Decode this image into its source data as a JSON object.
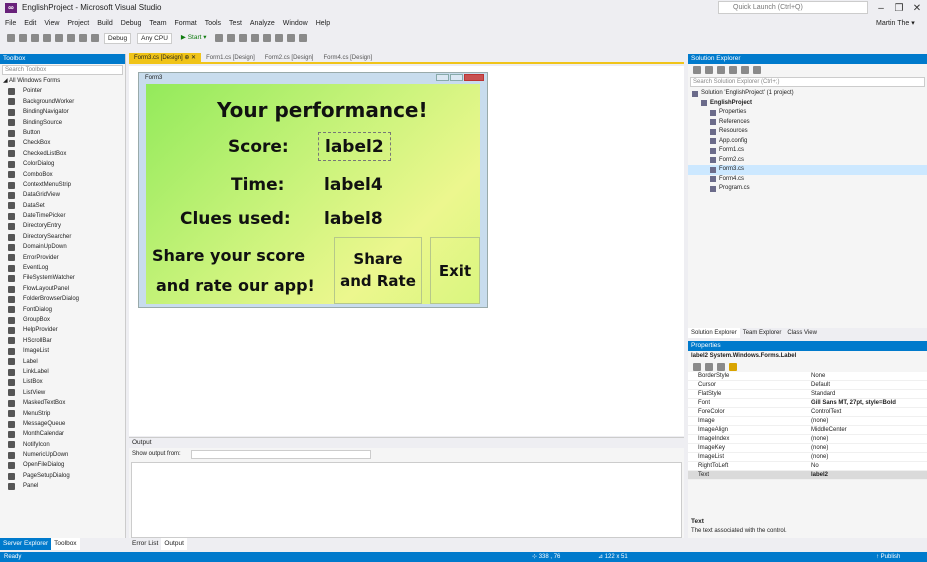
{
  "title": "EnglishProject - Microsoft Visual Studio",
  "quick_launch": "Quick Launch (Ctrl+Q)",
  "user": "Martin The ▾",
  "menu": [
    "File",
    "Edit",
    "View",
    "Project",
    "Build",
    "Debug",
    "Team",
    "Format",
    "Tools",
    "Test",
    "Analyze",
    "Window",
    "Help"
  ],
  "toolbar": {
    "config": "Debug",
    "platform": "Any CPU",
    "start": "▶ Start ▾"
  },
  "toolbox": {
    "title": "Toolbox",
    "search": "Search Toolbox",
    "group": "◢ All Windows Forms",
    "items": [
      "Pointer",
      "BackgroundWorker",
      "BindingNavigator",
      "BindingSource",
      "Button",
      "CheckBox",
      "CheckedListBox",
      "ColorDialog",
      "ComboBox",
      "ContextMenuStrip",
      "DataGridView",
      "DataSet",
      "DateTimePicker",
      "DirectoryEntry",
      "DirectorySearcher",
      "DomainUpDown",
      "ErrorProvider",
      "EventLog",
      "FileSystemWatcher",
      "FlowLayoutPanel",
      "FolderBrowserDialog",
      "FontDialog",
      "GroupBox",
      "HelpProvider",
      "HScrollBar",
      "ImageList",
      "Label",
      "LinkLabel",
      "ListBox",
      "ListView",
      "MaskedTextBox",
      "MenuStrip",
      "MessageQueue",
      "MonthCalendar",
      "NotifyIcon",
      "NumericUpDown",
      "OpenFileDialog",
      "PageSetupDialog",
      "Panel"
    ],
    "tabs": [
      "Server Explorer",
      "Toolbox"
    ]
  },
  "doctabs": [
    "Form3.cs [Design] ⊕ ✕",
    "Form1.cs [Design]",
    "Form2.cs [Design]",
    "Form4.cs [Design]"
  ],
  "form": {
    "title": "Form3",
    "heading": "Your performance!",
    "score_label": "Score:",
    "score_value": "label2",
    "time_label": "Time:",
    "time_value": "label4",
    "clues_label": "Clues used:",
    "clues_value": "label8",
    "share_line1": "Share your score",
    "share_line2": "and rate our app!",
    "share_btn_1": "Share",
    "share_btn_2": "and Rate",
    "exit_btn": "Exit"
  },
  "output": {
    "title": "Output",
    "show_from": "Show output from:",
    "tabs": [
      "Error List",
      "Output"
    ]
  },
  "solution": {
    "title": "Solution Explorer",
    "search": "Search Solution Explorer (Ctrl+;)",
    "items": [
      {
        "t": "Solution 'EnglishProject' (1 project)",
        "l": 0
      },
      {
        "t": "EnglishProject",
        "l": 1,
        "b": true
      },
      {
        "t": "Properties",
        "l": 2
      },
      {
        "t": "References",
        "l": 2
      },
      {
        "t": "Resources",
        "l": 2
      },
      {
        "t": "App.config",
        "l": 2
      },
      {
        "t": "Form1.cs",
        "l": 2
      },
      {
        "t": "Form2.cs",
        "l": 2
      },
      {
        "t": "Form3.cs",
        "l": 2,
        "sel": true
      },
      {
        "t": "Form4.cs",
        "l": 2
      },
      {
        "t": "Program.cs",
        "l": 2
      }
    ],
    "tabs": [
      "Solution Explorer",
      "Team Explorer",
      "Class View"
    ]
  },
  "properties": {
    "title": "Properties",
    "object": "label2  System.Windows.Forms.Label",
    "rows": [
      [
        "BorderStyle",
        "None"
      ],
      [
        "Cursor",
        "Default"
      ],
      [
        "FlatStyle",
        "Standard"
      ],
      [
        "Font",
        "Gill Sans MT, 27pt, style=Bold"
      ],
      [
        "ForeColor",
        "ControlText"
      ],
      [
        "Image",
        "(none)"
      ],
      [
        "ImageAlign",
        "MiddleCenter"
      ],
      [
        "ImageIndex",
        "(none)"
      ],
      [
        "ImageKey",
        "(none)"
      ],
      [
        "ImageList",
        "(none)"
      ],
      [
        "RightToLeft",
        "No"
      ],
      [
        "Text",
        "label2"
      ]
    ],
    "desc_title": "Text",
    "desc": "The text associated with the control."
  },
  "status": {
    "left": "Ready",
    "pos": "⊹ 338 , 76",
    "size": "⊿ 122 x 51",
    "publish": "↑ Publish"
  }
}
